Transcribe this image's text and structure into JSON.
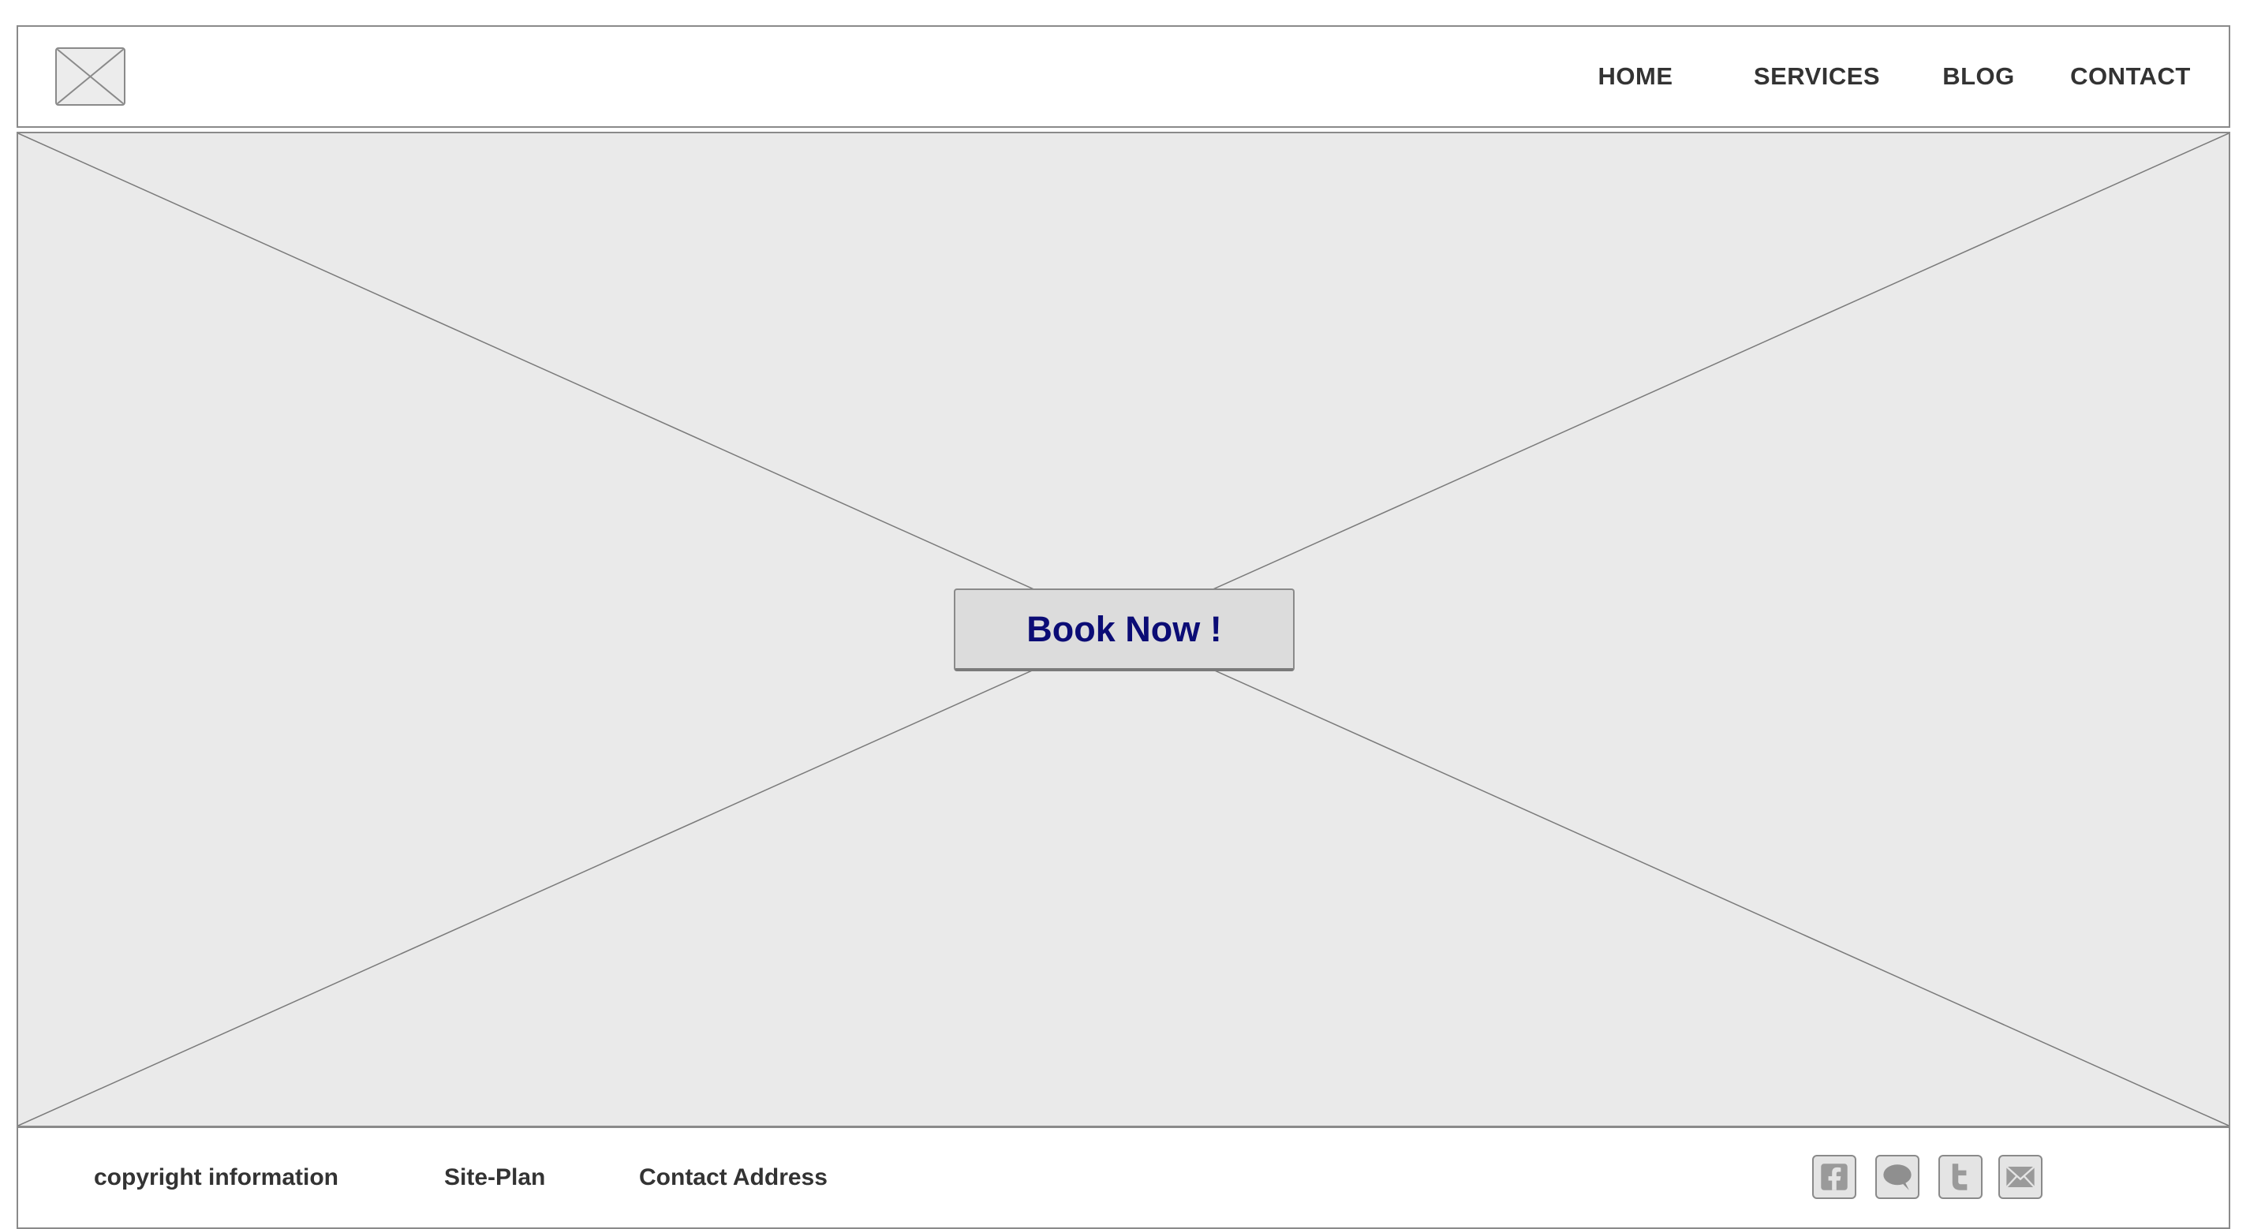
{
  "header": {
    "logo_icon": "image-placeholder-icon",
    "nav": [
      {
        "label": "HOME"
      },
      {
        "label": "SERVICES"
      },
      {
        "label": "BLOG"
      },
      {
        "label": "CONTACT"
      }
    ]
  },
  "hero": {
    "background_icon": "image-placeholder-icon",
    "cta_label": "Book Now !"
  },
  "footer": {
    "copyright": "copyright information",
    "siteplan": "Site-Plan",
    "contact_address": "Contact Address",
    "social_icons": [
      "facebook-icon",
      "chat-icon",
      "twitter-icon",
      "email-icon"
    ]
  },
  "colors": {
    "placeholder_bg": "#eaeaea",
    "border": "#8a8a8a",
    "cta_text": "#0b0c75",
    "nav_text": "#333333"
  }
}
